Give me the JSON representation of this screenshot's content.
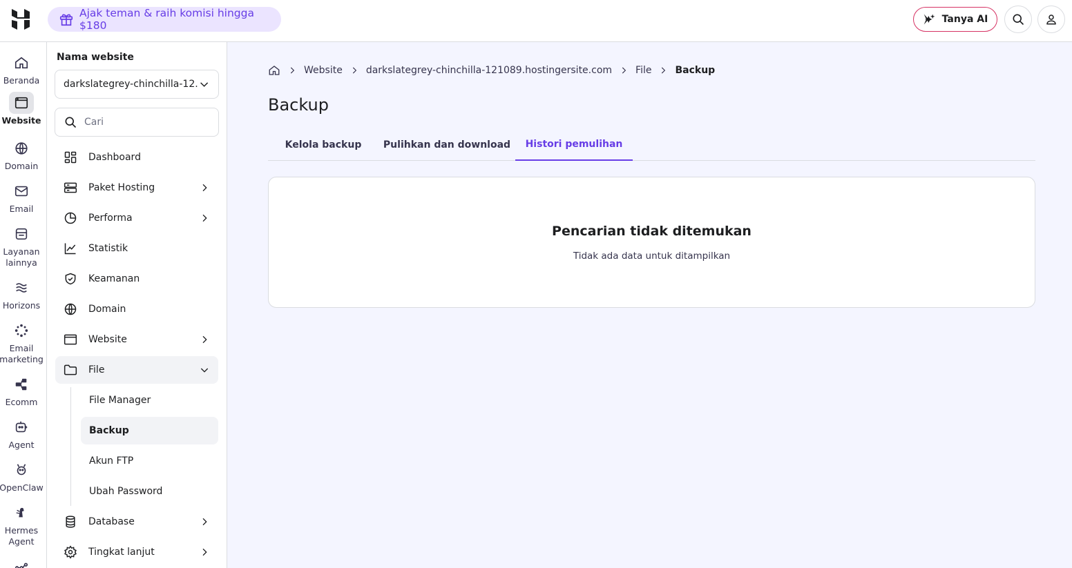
{
  "topbar": {
    "promo_text": "Ajak teman & raih komisi hingga $180",
    "ai_button_label": "Tanya AI"
  },
  "rail": {
    "items": [
      {
        "label": "Beranda",
        "icon": "home-icon"
      },
      {
        "label": "Website",
        "icon": "browser-icon",
        "active": true
      },
      {
        "label": "Domain",
        "icon": "globe-icon"
      },
      {
        "label": "Email",
        "icon": "mail-icon"
      },
      {
        "label": "Layanan lainnya",
        "icon": "store-icon"
      },
      {
        "label": "Horizons",
        "icon": "horizons-icon"
      },
      {
        "label": "Email marketing",
        "icon": "reach-icon"
      },
      {
        "label": "Ecomm",
        "icon": "ecomm-icon"
      },
      {
        "label": "Agent",
        "icon": "robot-icon"
      },
      {
        "label": "OpenClaw",
        "icon": "claw-icon"
      },
      {
        "label": "Hermes Agent",
        "icon": "hermes-icon"
      }
    ]
  },
  "sidenav": {
    "title": "Nama website",
    "site_value": "darkslategrey-chinchilla-12...",
    "search_placeholder": "Cari",
    "items": [
      {
        "label": "Dashboard",
        "icon": "dashboard-icon"
      },
      {
        "label": "Paket Hosting",
        "icon": "server-icon"
      },
      {
        "label": "Performa",
        "icon": "pie-icon"
      },
      {
        "label": "Statistik",
        "icon": "chart-icon"
      },
      {
        "label": "Keamanan",
        "icon": "shield-icon"
      },
      {
        "label": "Domain",
        "icon": "globe-icon"
      },
      {
        "label": "Website",
        "icon": "browser-icon"
      },
      {
        "label": "File",
        "icon": "folder-icon"
      },
      {
        "label": "Database",
        "icon": "database-icon"
      },
      {
        "label": "Tingkat lanjut",
        "icon": "gear-icon"
      }
    ],
    "file_sub": [
      "File Manager",
      "Backup",
      "Akun FTP",
      "Ubah Password"
    ]
  },
  "breadcrumb": [
    "Website",
    "darkslategrey-chinchilla-121089.hostingersite.com",
    "File",
    "Backup"
  ],
  "page": {
    "title": "Backup",
    "tabs": [
      "Kelola backup",
      "Pulihkan dan download",
      "Histori pemulihan"
    ],
    "empty_title": "Pencarian tidak ditemukan",
    "empty_subtitle": "Tidak ada data untuk ditampilkan"
  },
  "colors": {
    "accent": "#673de6",
    "promo_bg": "#ebe4ff",
    "ai_border": "#d63163"
  }
}
